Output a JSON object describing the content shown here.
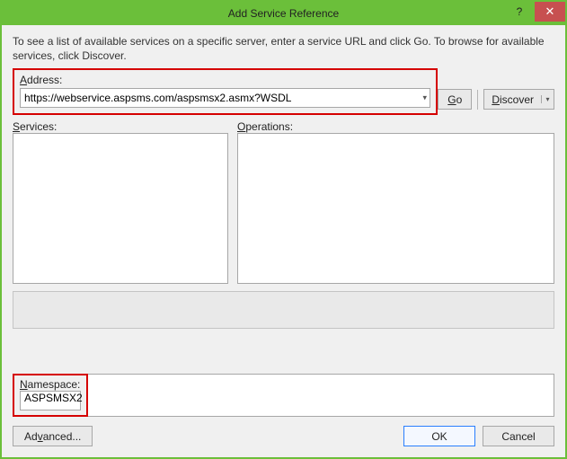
{
  "title": "Add Service Reference",
  "instructions": "To see a list of available services on a specific server, enter a service URL and click Go. To browse for available services, click Discover.",
  "address": {
    "label": "Address:",
    "label_ul": "A",
    "label_rest": "ddress:",
    "value": "https://webservice.aspsms.com/aspsmsx2.asmx?WSDL"
  },
  "buttons": {
    "go": "Go",
    "go_ul": "G",
    "go_rest": "o",
    "discover": "Discover",
    "discover_ul": "D",
    "discover_rest": "iscover",
    "advanced": "Advanced...",
    "advanced_ul": "v",
    "advanced_pre": "Ad",
    "advanced_post": "anced...",
    "ok": "OK",
    "cancel": "Cancel"
  },
  "labels": {
    "services": "Services:",
    "services_ul": "S",
    "services_rest": "ervices:",
    "operations": "Operations:",
    "operations_ul": "O",
    "operations_rest": "perations:",
    "namespace": "Namespace:",
    "namespace_ul": "N",
    "namespace_rest": "amespace:"
  },
  "namespace": {
    "value": "ASPSMSX2"
  }
}
